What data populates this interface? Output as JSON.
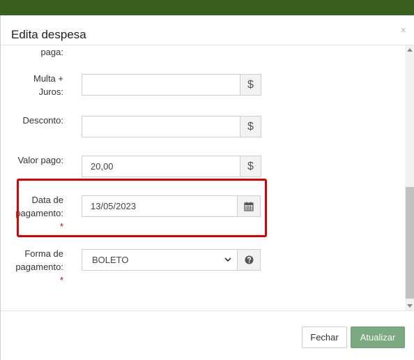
{
  "modal": {
    "title": "Edita despesa",
    "close_symbol": "×"
  },
  "form": {
    "partial_label": "paga:",
    "multa": {
      "label_line1": "Multa +",
      "label_line2": "Juros:",
      "value": "",
      "addon_icon": "dollar-icon",
      "addon_symbol": "$"
    },
    "desconto": {
      "label": "Desconto:",
      "value": "",
      "addon_icon": "dollar-icon",
      "addon_symbol": "$"
    },
    "valor_pago": {
      "label": "Valor pago:",
      "value": "20,00",
      "addon_icon": "dollar-icon",
      "addon_symbol": "$"
    },
    "data_pagamento": {
      "label_line1": "Data de",
      "label_line2": "pagamento:",
      "required_mark": "*",
      "value": "13/05/2023",
      "addon_icon": "calendar-icon"
    },
    "forma_pagamento": {
      "label_line1": "Forma de",
      "label_line2": "pagamento:",
      "required_mark": "*",
      "selected": "BOLETO",
      "addon_icon": "question-circle-icon"
    }
  },
  "footer": {
    "close_label": "Fechar",
    "update_label": "Atualizar"
  },
  "colors": {
    "top_strip": "#3a5f1c",
    "required": "#cc0000",
    "highlight_border": "#e00000",
    "update_button": "#7aa87f"
  }
}
